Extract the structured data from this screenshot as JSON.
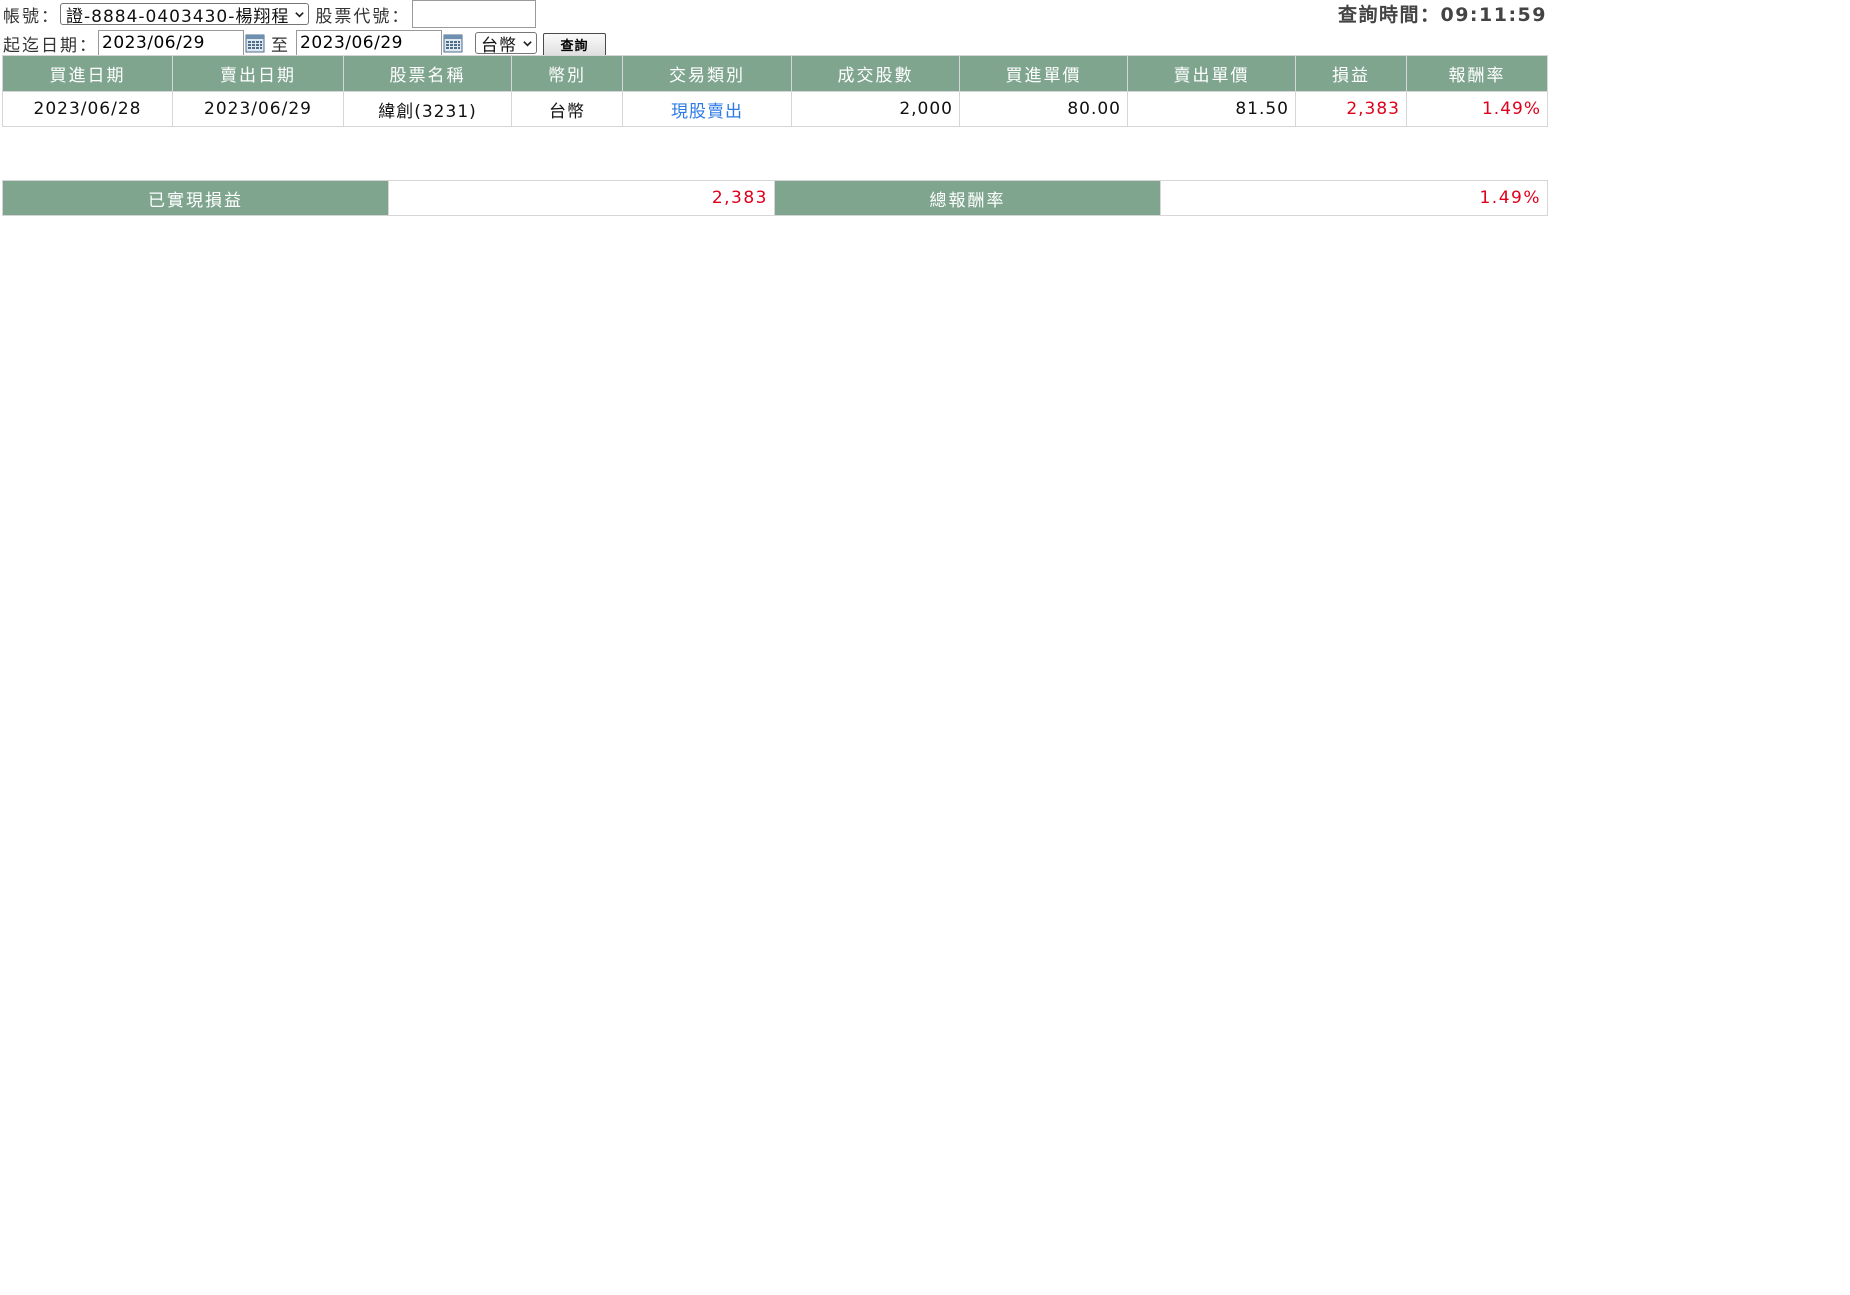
{
  "filters": {
    "account_label": "帳號：",
    "account_value": "證-8884-0403430-楊翔程",
    "stock_code_label": "股票代號：",
    "stock_code_value": "",
    "date_range_label": "起迄日期：",
    "start_date": "2023/06/29",
    "to_label": "至",
    "end_date": "2023/06/29",
    "currency_value": "台幣",
    "query_button": "查詢"
  },
  "query_time": "查詢時間：09:11:59",
  "table": {
    "headers": [
      "買進日期",
      "賣出日期",
      "股票名稱",
      "幣別",
      "交易類別",
      "成交股數",
      "買進單價",
      "賣出單價",
      "損益",
      "報酬率"
    ],
    "rows": [
      {
        "buy_date": "2023/06/28",
        "sell_date": "2023/06/29",
        "stock_name": "緯創(3231)",
        "currency": "台幣",
        "trade_type": "現股賣出",
        "shares": "2,000",
        "buy_price": "80.00",
        "sell_price": "81.50",
        "profit": "2,383",
        "return_rate": "1.49%"
      }
    ]
  },
  "summary": {
    "realized_label": "已實現損益",
    "realized_value": "2,383",
    "total_return_label": "總報酬率",
    "total_return_value": "1.49%"
  },
  "colors": {
    "header_green": "#7fa58f",
    "positive_red": "#e0001b",
    "link_blue": "#2c7be5"
  },
  "icons": [
    "chevron-down-icon",
    "calendar-icon"
  ]
}
